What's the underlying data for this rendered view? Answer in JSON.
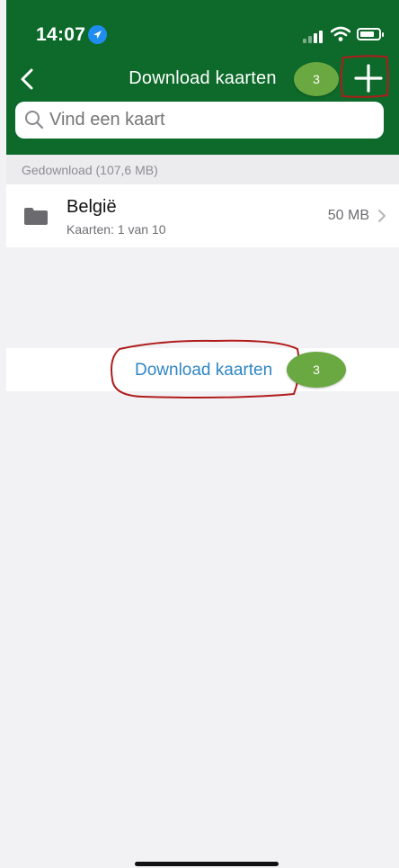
{
  "status_bar": {
    "time": "14:07"
  },
  "nav": {
    "title": "Download kaarten",
    "badge": "3"
  },
  "search": {
    "placeholder": "Vind een kaart"
  },
  "section": {
    "label": "Gedownload (107,6 MB)"
  },
  "rows": [
    {
      "title": "België",
      "subtitle": "Kaarten: 1 van 10",
      "size": "50 MB"
    }
  ],
  "download_link": {
    "label": "Download kaarten",
    "badge": "3"
  },
  "colors": {
    "header": "#0d6a2a",
    "badge": "#6aa842",
    "link": "#2f86c7",
    "annotation": "#b01c1c"
  }
}
